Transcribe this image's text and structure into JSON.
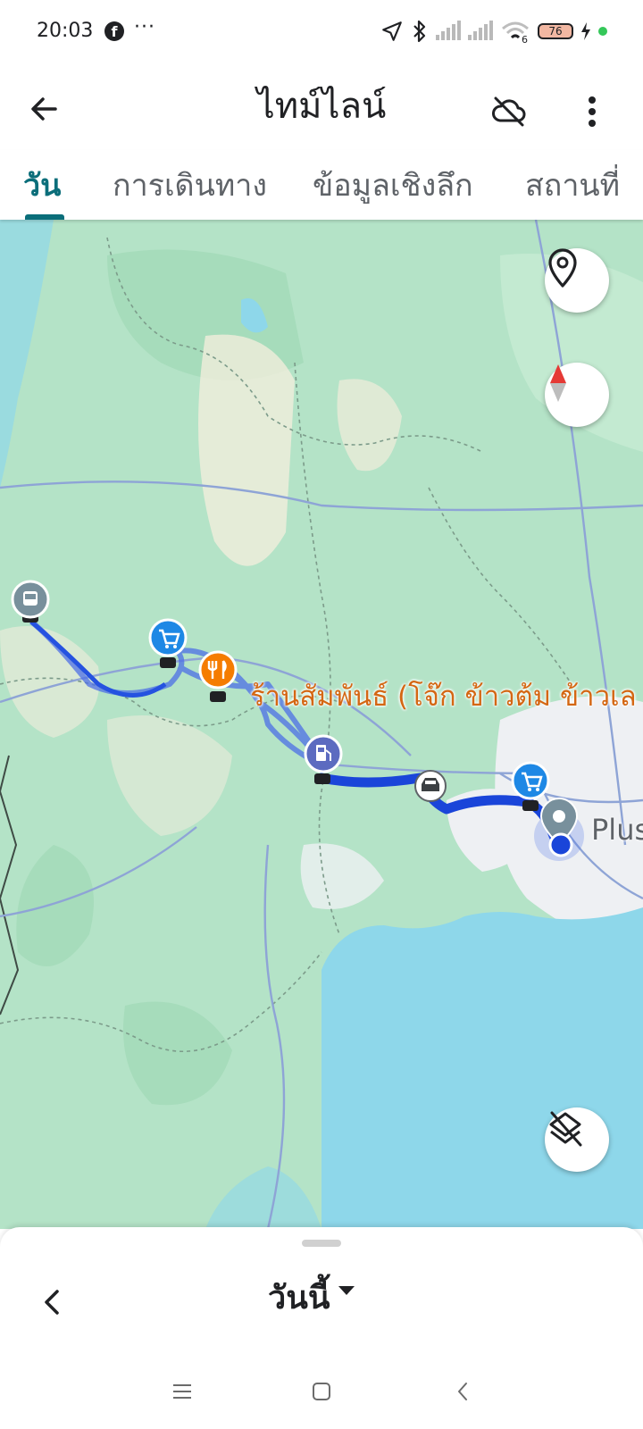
{
  "status_bar": {
    "time": "20:03",
    "more": "···",
    "wifi_badge": "6",
    "battery": "76"
  },
  "app_bar": {
    "title": "ไทม์ไลน์",
    "back_icon": "arrow-back-icon",
    "cloud_icon": "cloud-off-icon",
    "menu_icon": "more-vert-icon"
  },
  "tabs": [
    {
      "label": "วัน",
      "active": true
    },
    {
      "label": "การเดินทาง",
      "active": false
    },
    {
      "label": "ข้อมูลเชิงลึก",
      "active": false
    },
    {
      "label": "สถานที่",
      "active": false
    }
  ],
  "map": {
    "poi_label": "ร้านสัมพันธ์ (โจ๊ก ข้าวต้ม ข้าวเล",
    "place_label": "Plus",
    "colors": {
      "land": "#b4e3c7",
      "sea": "#8ed7ea",
      "route": "#1a45d9",
      "route_alt": "#4d6fe6",
      "poi_accent": "#d46713"
    },
    "markers": [
      "train-icon",
      "shopping-cart-icon",
      "restaurant-icon",
      "gas-station-icon",
      "car-icon",
      "shopping-cart-icon",
      "location-pin-icon"
    ]
  },
  "bottom_sheet": {
    "date_label": "วันนี้"
  },
  "nav_bar": {
    "buttons": [
      "menu-icon",
      "home-icon",
      "back-icon"
    ]
  }
}
